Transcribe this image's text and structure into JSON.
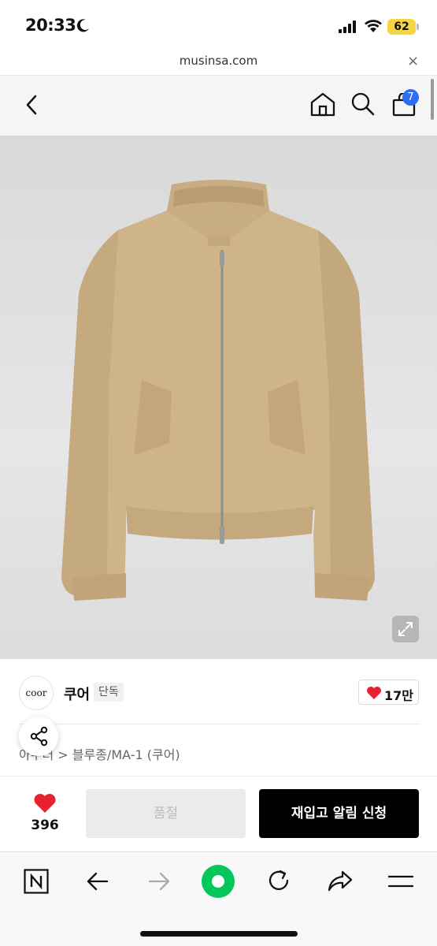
{
  "status_bar": {
    "time": "20:33",
    "battery": "62"
  },
  "browser": {
    "url": "musinsa.com",
    "close_icon": "×"
  },
  "header": {
    "cart_count": "7"
  },
  "brand": {
    "logo_text": "coor",
    "name": "쿠어",
    "badge": "단독",
    "likes": "17만"
  },
  "breadcrumb": {
    "partial": "아우터",
    "separator": ">",
    "category": "블루종/MA-1 (쿠어)"
  },
  "purchase": {
    "like_count": "396",
    "soldout_label": "품절",
    "restock_label": "재입고 알림 신청"
  },
  "colors": {
    "accent_red": "#e8212e",
    "badge_blue": "#2f6df5",
    "toolbar_green": "#03c75a",
    "jacket_beige": "#cfb48a"
  }
}
